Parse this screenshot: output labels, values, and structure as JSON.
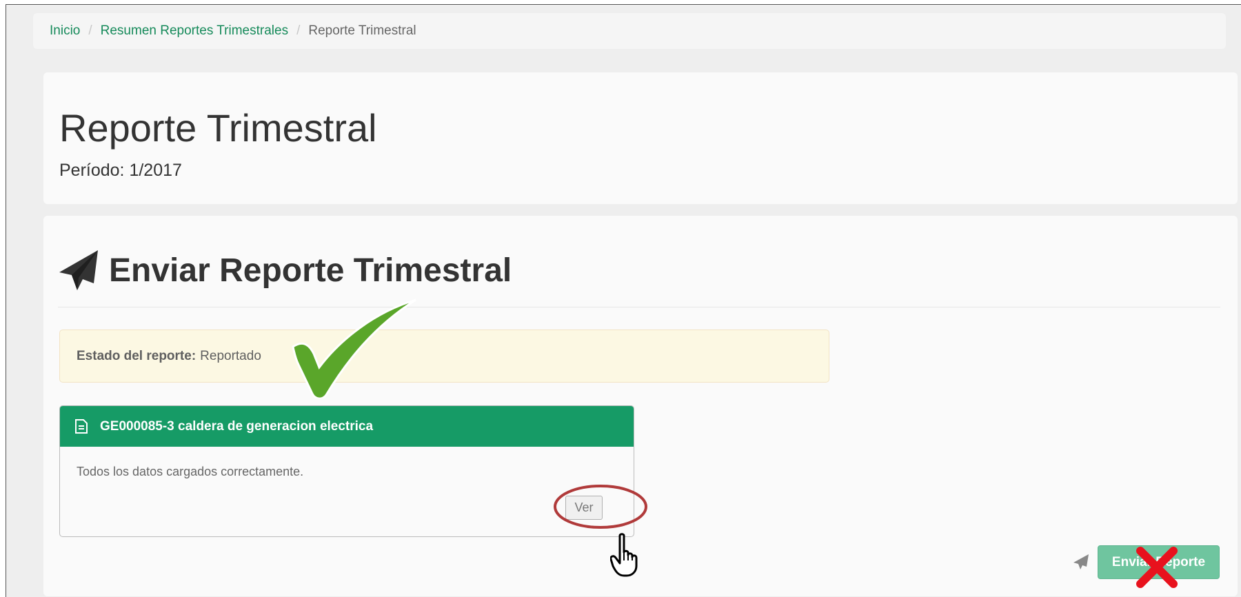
{
  "breadcrumb": {
    "home": "Inicio",
    "summary": "Resumen Reportes Trimestrales",
    "current": "Reporte Trimestral",
    "separator": "/"
  },
  "header": {
    "title": "Reporte Trimestral",
    "period": "Período: 1/2017"
  },
  "send_section": {
    "title": "Enviar Reporte Trimestral",
    "status_label": "Estado del reporte:",
    "status_value": "Reportado",
    "card": {
      "title": "GE000085-3 caldera de generacion electrica",
      "message": "Todos los datos cargados correctamente.",
      "view_button": "Ver"
    },
    "send_button": "Enviar Reporte"
  },
  "colors": {
    "accent": "#169b66",
    "link": "#168a5a",
    "alert_bg": "#fcf8e3",
    "check_green": "#5aa62a",
    "highlight_red": "#b03a3a",
    "x_red": "#e8121d"
  },
  "icons": {
    "section": "paper-plane-icon",
    "card": "document-icon",
    "annotation_ok": "checkmark-icon",
    "annotation_ring": "highlight-ellipse",
    "pointer": "hand-cursor-icon",
    "annotation_no": "red-x-icon"
  }
}
